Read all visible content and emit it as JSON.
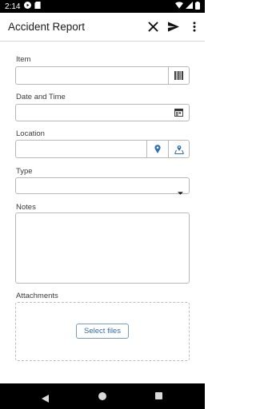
{
  "status_bar": {
    "time": "2:14",
    "icons": [
      "play-icon",
      "sd-card-icon",
      "wifi-icon",
      "signal-icon",
      "battery-icon"
    ]
  },
  "app_bar": {
    "title": "Accident Report",
    "actions": [
      "close-icon",
      "send-icon",
      "more-vert-icon"
    ]
  },
  "form": {
    "item": {
      "label": "Item",
      "value": "",
      "icon": "barcode-icon"
    },
    "date_time": {
      "label": "Date and Time",
      "value": "",
      "icon": "calendar-icon"
    },
    "location": {
      "label": "Location",
      "value": "",
      "icons": [
        "location-pin-icon",
        "map-icon"
      ]
    },
    "type": {
      "label": "Type",
      "value": "",
      "icon": "dropdown-arrow-icon"
    },
    "notes": {
      "label": "Notes",
      "value": ""
    },
    "attachments": {
      "label": "Attachments",
      "button_label": "Select files"
    }
  },
  "nav_bar": {
    "icons": [
      "back-icon",
      "home-icon",
      "recents-icon"
    ]
  },
  "colors": {
    "accent": "#2f6db5",
    "border": "#b8b8b8"
  }
}
